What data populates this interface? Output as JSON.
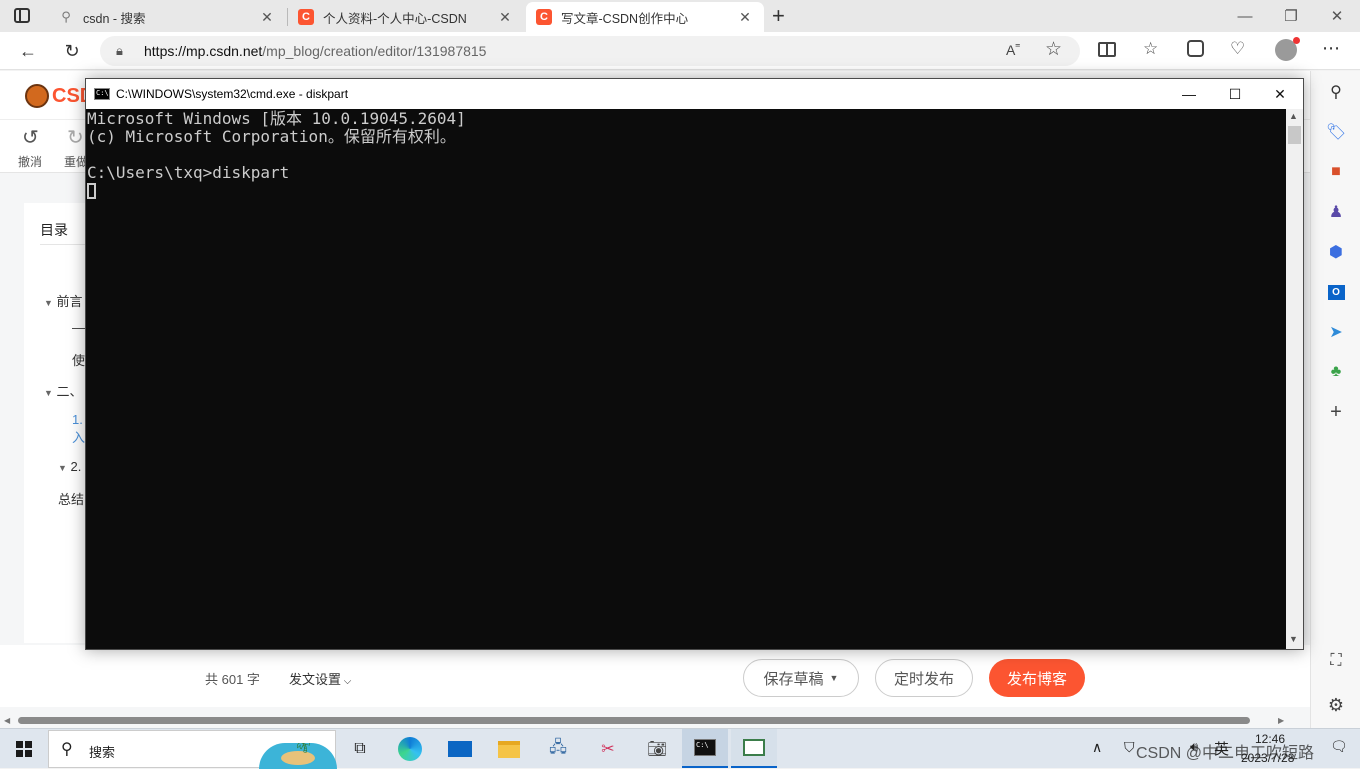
{
  "browser": {
    "tabs": [
      {
        "title": "csdn - 搜索",
        "favicon": "search-icon",
        "active": false
      },
      {
        "title": "个人资料-个人中心-CSDN",
        "favicon": "csdn-logo",
        "active": false
      },
      {
        "title": "写文章-CSDN创作中心",
        "favicon": "csdn-logo",
        "active": true
      }
    ],
    "favicon_letter": "C",
    "new_tab": "+",
    "url_host": "https://mp.csdn.net",
    "url_path": "/mp_blog/creation/editor/131987815",
    "read_aloud": "A˭"
  },
  "page": {
    "logo": "CSD",
    "undo_label": "撤消",
    "redo_label": "重做",
    "toc_title": "目录",
    "toc": {
      "preface": "前言",
      "dash": "—",
      "use": "使",
      "section2": "二、",
      "sub1": "1.",
      "sub1b": "入",
      "sub2": "2.",
      "summary": "总结"
    },
    "word_count": "共 601 字",
    "post_settings": "发文设置",
    "save_draft": "保存草稿",
    "schedule": "定时发布",
    "publish": "发布博客"
  },
  "cmd": {
    "title": "C:\\WINDOWS\\system32\\cmd.exe - diskpart",
    "lines": [
      "Microsoft Windows [版本 10.0.19045.2604]",
      "(c) Microsoft Corporation。保留所有权利。",
      "",
      "C:\\Users\\txq>diskpart"
    ]
  },
  "taskbar": {
    "search_label": "搜索",
    "tray_text": "CSDN @中二电工吹短路",
    "ime": "英",
    "time": "12:46",
    "date": "2023/7/28"
  },
  "colors": {
    "csdn_accent": "#fc5531",
    "console_bg": "#0c0c0c",
    "console_fg": "#cccccc",
    "link_blue": "#4a90d9"
  }
}
